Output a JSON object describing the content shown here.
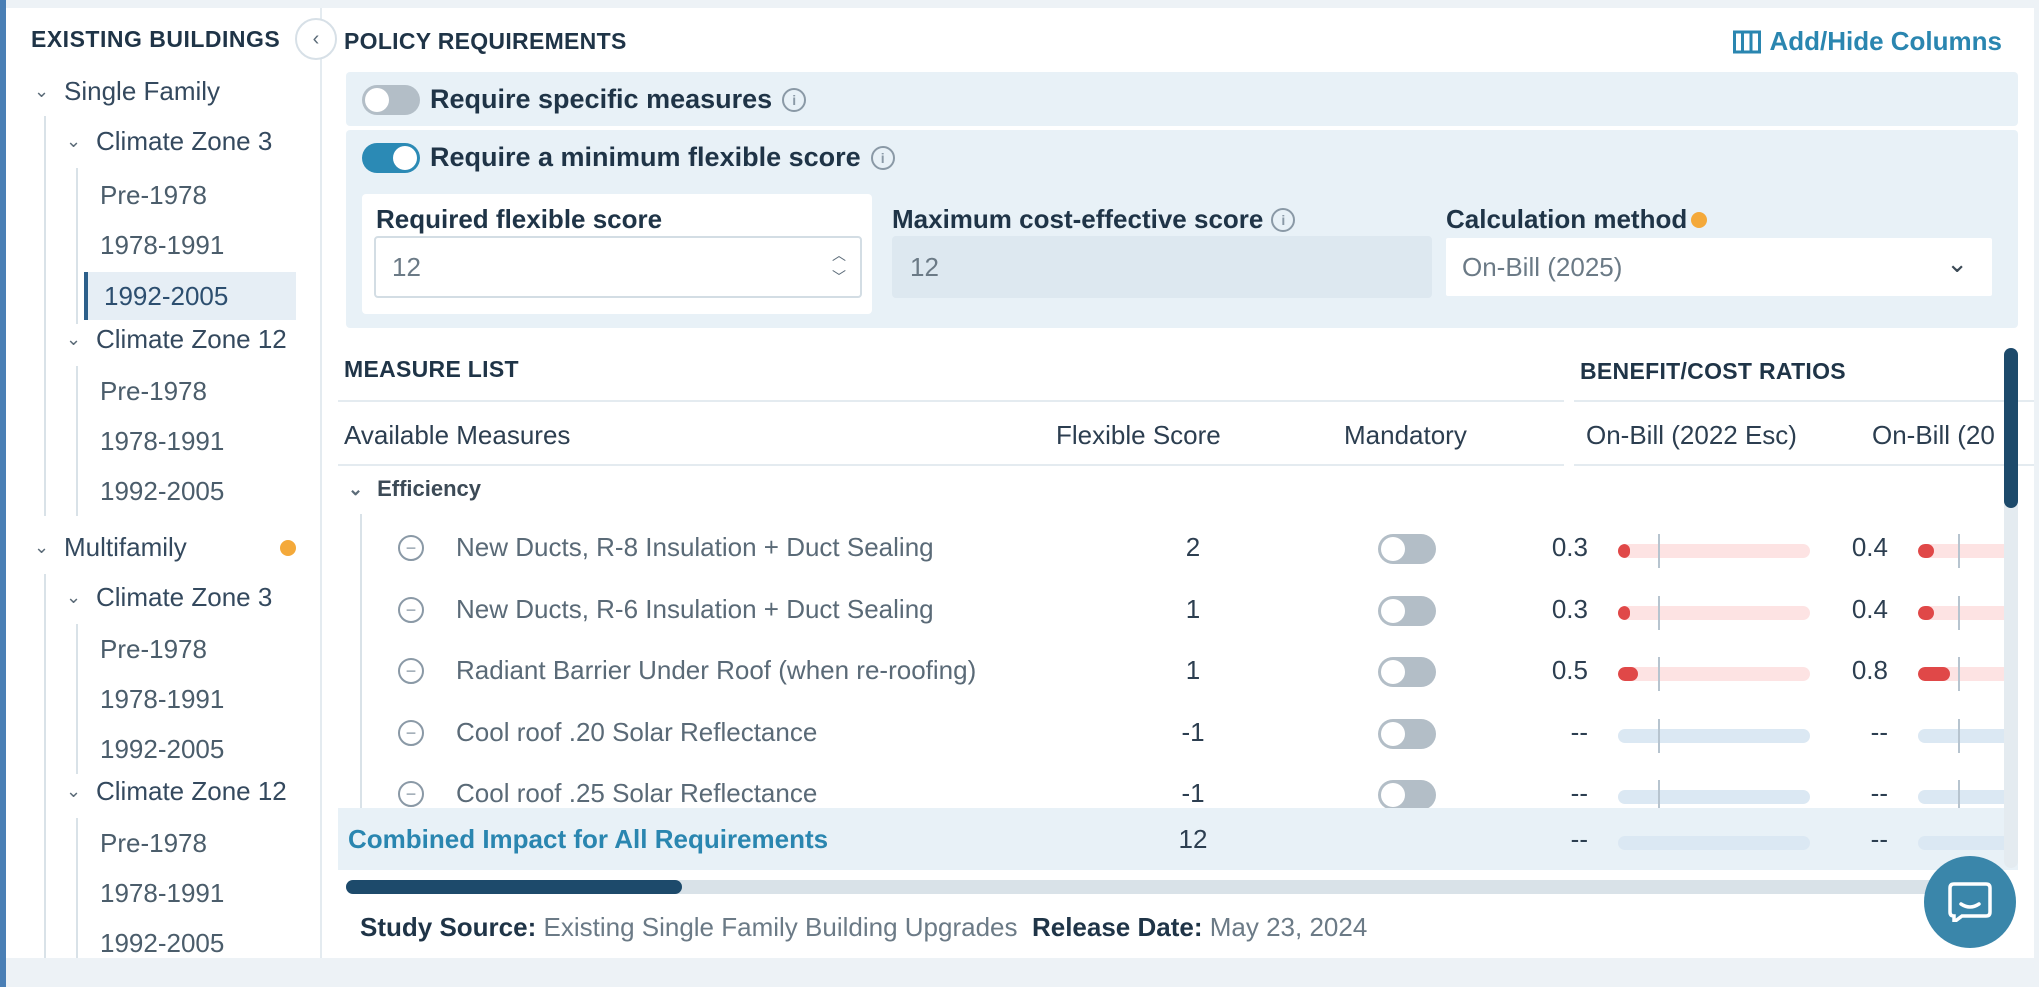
{
  "sidebar": {
    "title": "EXISTING BUILDINGS",
    "collapse_icon": "chevron-left-icon",
    "groups": [
      {
        "label": "Single Family",
        "zones": [
          {
            "label": "Climate Zone 3",
            "vintages": [
              "Pre-1978",
              "1978-1991",
              "1992-2005"
            ],
            "selected": "1992-2005"
          },
          {
            "label": "Climate Zone 12",
            "vintages": [
              "Pre-1978",
              "1978-1991",
              "1992-2005"
            ]
          }
        ]
      },
      {
        "label": "Multifamily",
        "has_badge": true,
        "zones": [
          {
            "label": "Climate Zone 3",
            "vintages": [
              "Pre-1978",
              "1978-1991",
              "1992-2005"
            ]
          },
          {
            "label": "Climate Zone 12",
            "vintages": [
              "Pre-1978",
              "1978-1991",
              "1992-2005"
            ]
          }
        ]
      }
    ]
  },
  "policy": {
    "title": "POLICY REQUIREMENTS",
    "add_hide_columns": "Add/Hide Columns",
    "toggle_specific": {
      "label": "Require specific measures",
      "on": false
    },
    "toggle_flexible": {
      "label": "Require a minimum flexible score",
      "on": true
    },
    "required_score": {
      "label": "Required flexible score",
      "value": "12"
    },
    "max_score": {
      "label": "Maximum cost-effective score",
      "value": "12"
    },
    "calc_method": {
      "label": "Calculation method",
      "value": "On-Bill (2025)"
    }
  },
  "measures": {
    "section_title": "MEASURE LIST",
    "ratios_title": "BENEFIT/COST RATIOS",
    "columns": {
      "available": "Available Measures",
      "flexible": "Flexible Score",
      "mandatory": "Mandatory",
      "ratio1": "On-Bill (2022 Esc)",
      "ratio2": "On-Bill (20"
    },
    "group_label": "Efficiency",
    "rows": [
      {
        "name": "New Ducts, R-8 Insulation + Duct Sealing",
        "score": "2",
        "mandatory": false,
        "r1": "0.3",
        "r1_value": 0.3,
        "r2": "0.4",
        "r2_value": 0.4
      },
      {
        "name": "New Ducts, R-6 Insulation + Duct Sealing",
        "score": "1",
        "mandatory": false,
        "r1": "0.3",
        "r1_value": 0.3,
        "r2": "0.4",
        "r2_value": 0.4
      },
      {
        "name": "Radiant Barrier Under Roof (when re-roofing)",
        "score": "1",
        "mandatory": false,
        "r1": "0.5",
        "r1_value": 0.5,
        "r2": "0.8",
        "r2_value": 0.8
      },
      {
        "name": "Cool roof .20 Solar Reflectance",
        "score": "-1",
        "mandatory": false,
        "r1": "--",
        "r1_value": null,
        "r2": "--",
        "r2_value": null
      },
      {
        "name": "Cool roof .25 Solar Reflectance",
        "score": "-1",
        "mandatory": false,
        "r1": "--",
        "r1_value": null,
        "r2": "--",
        "r2_value": null
      }
    ],
    "combined": {
      "label": "Combined Impact for All Requirements",
      "score": "12",
      "r1": "--",
      "r2": "--"
    }
  },
  "footer": {
    "source_label": "Study Source:",
    "source_value": "Existing Single Family Building Upgrades",
    "release_label": "Release Date:",
    "release_value": "May 23, 2024"
  },
  "colors": {
    "accent": "#2a86b0",
    "badge": "#f4a93a",
    "ratio_fill": "#e04848"
  }
}
